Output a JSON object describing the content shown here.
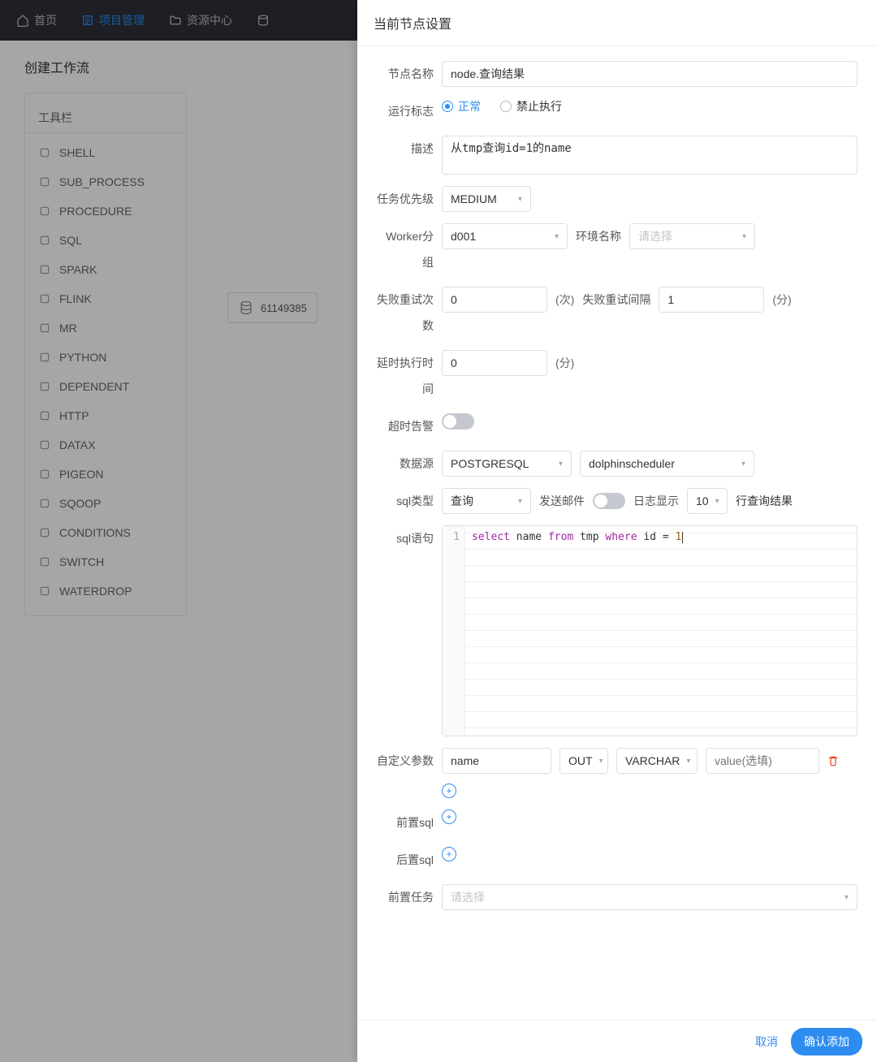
{
  "nav": {
    "home": "首页",
    "project": "项目管理",
    "resource": "资源中心"
  },
  "breadcrumb": "创建工作流",
  "toolbar": {
    "title": "工具栏",
    "items": [
      {
        "label": "SHELL"
      },
      {
        "label": "SUB_PROCESS"
      },
      {
        "label": "PROCEDURE"
      },
      {
        "label": "SQL"
      },
      {
        "label": "SPARK"
      },
      {
        "label": "FLINK"
      },
      {
        "label": "MR"
      },
      {
        "label": "PYTHON"
      },
      {
        "label": "DEPENDENT"
      },
      {
        "label": "HTTP"
      },
      {
        "label": "DATAX"
      },
      {
        "label": "PIGEON"
      },
      {
        "label": "SQOOP"
      },
      {
        "label": "CONDITIONS"
      },
      {
        "label": "SWITCH"
      },
      {
        "label": "WATERDROP"
      }
    ]
  },
  "canvas": {
    "node_id": "61149385"
  },
  "drawer": {
    "title": "当前节点设置",
    "labels": {
      "node_name": "节点名称",
      "run_flag": "运行标志",
      "normal": "正常",
      "forbid": "禁止执行",
      "desc": "描述",
      "priority": "任务优先级",
      "worker_group": "Worker分组",
      "env_name": "环境名称",
      "retry_count": "失败重试次数",
      "retry_count_unit": "(次)",
      "retry_interval": "失败重试间隔",
      "retry_interval_unit": "(分)",
      "delay": "延时执行时间",
      "delay_unit": "(分)",
      "timeout_alarm": "超时告警",
      "datasource": "数据源",
      "sql_type": "sql类型",
      "send_mail": "发送邮件",
      "log_display": "日志显示",
      "log_display_suffix": "行查询结果",
      "sql_statement": "sql语句",
      "custom_param": "自定义参数",
      "pre_sql": "前置sql",
      "post_sql": "后置sql",
      "pre_task": "前置任务",
      "please_select": "请选择",
      "value_placeholder": "value(选填)"
    },
    "values": {
      "node_name": "node.查询结果",
      "desc": "从tmp查询id=1的name",
      "priority": "MEDIUM",
      "worker_group": "d001",
      "retry_count": "0",
      "retry_interval": "1",
      "delay": "0",
      "datasource_type": "POSTGRESQL",
      "datasource_name": "dolphinscheduler",
      "sql_type": "查询",
      "log_rows": "10",
      "param_name": "name",
      "param_dir": "OUT",
      "param_type": "VARCHAR"
    },
    "sql": {
      "line_no": "1",
      "select": "select",
      "name": "name",
      "from": "from",
      "tmp": "tmp",
      "where": "where",
      "id": "id",
      "eq": "=",
      "one": "1"
    },
    "footer": {
      "cancel": "取消",
      "confirm": "确认添加"
    }
  }
}
